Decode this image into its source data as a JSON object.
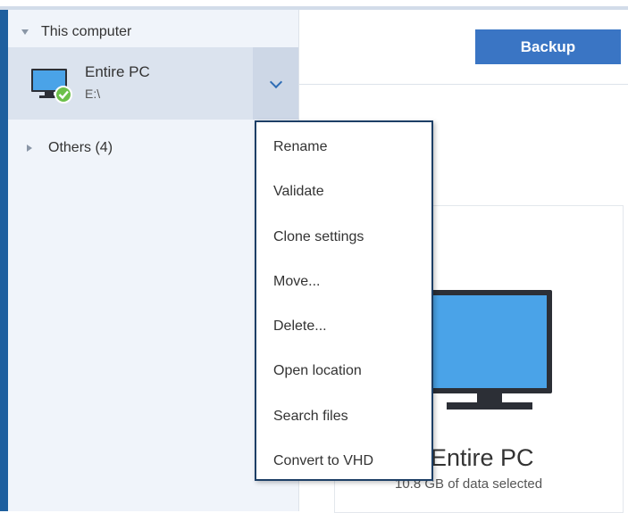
{
  "sidebar": {
    "group_label": "This computer",
    "selected_item": {
      "name": "Entire PC",
      "path": "E:\\"
    },
    "others_label": "Others (4)"
  },
  "toolbar": {
    "backup_label": "Backup"
  },
  "context_menu": {
    "items": [
      "Rename",
      "Validate",
      "Clone settings",
      "Move...",
      "Delete...",
      "Open location",
      "Search files",
      "Convert to VHD"
    ]
  },
  "main": {
    "card_title": "Entire PC",
    "card_subtitle": "10.8 GB of data selected"
  },
  "colors": {
    "accent": "#3a75c4",
    "sidebar_bg": "#f0f4fa",
    "selected_bg": "#dbe3ee",
    "menu_border": "#1d3f66",
    "status_ok": "#6cc04a"
  }
}
